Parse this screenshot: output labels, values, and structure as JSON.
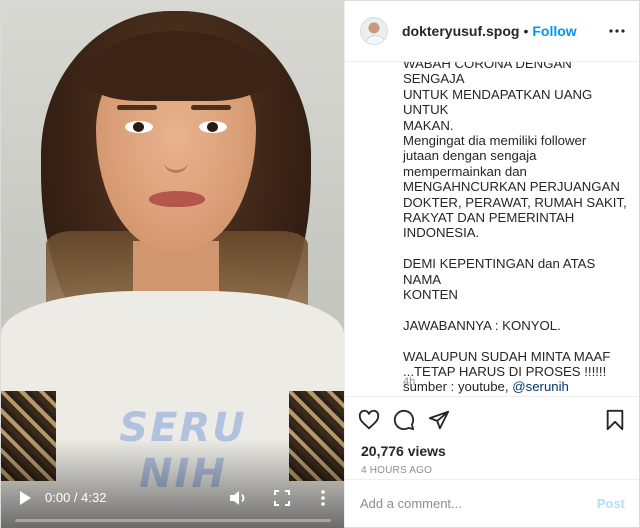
{
  "video": {
    "watermark": "SERU NIH",
    "time": "0:00 / 4:32",
    "progress": 0.0,
    "icons": {
      "play": "play-icon",
      "volume": "volume-icon",
      "fullscreen": "fullscreen-icon",
      "more": "more-vertical-icon"
    }
  },
  "header": {
    "username": "dokteryusuf.spog",
    "separator": "•",
    "follow_label": "Follow",
    "more_icon": "more-horizontal-icon"
  },
  "caption": {
    "lines": [
      "WABAH CORONA DENGAN SENGAJA",
      "UNTUK MENDAPATKAN UANG UNTUK",
      "MAKAN.",
      "Mengingat dia memiliki follower",
      "jutaan dengan sengaja",
      "mempermainkan dan",
      "MENGAHNCURKAN PERJUANGAN",
      "DOKTER, PERAWAT, RUMAH SAKIT,",
      "RAKYAT DAN PEMERINTAH",
      "INDONESIA.",
      "",
      "DEMI KEPENTINGAN dan ATAS NAMA",
      "KONTEN",
      "",
      "JAWABANNYA : KONYOL.",
      "",
      "WALAUPUN SUDAH MINTA MAAF",
      "...TETAP HARUS DI PROSES !!!!!!"
    ],
    "source_prefix": "sumber : youtube, ",
    "mention": "@serunih",
    "age": "4h"
  },
  "actions": {
    "like_icon": "heart-icon",
    "comment_icon": "comment-icon",
    "share_icon": "share-icon",
    "save_icon": "bookmark-icon"
  },
  "stats": {
    "views": "20,776 views",
    "timestamp": "4 HOURS AGO"
  },
  "comment": {
    "placeholder": "Add a comment...",
    "post_label": "Post"
  },
  "colors": {
    "link": "#0095f6",
    "mention": "#00376b",
    "muted": "#8e8e8e",
    "post_disabled": "#b2dffc"
  }
}
